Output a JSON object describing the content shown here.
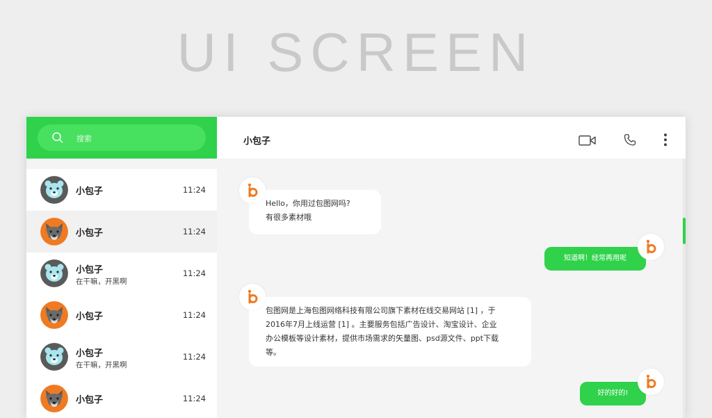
{
  "headline": "UI SCREEN",
  "search": {
    "placeholder": "搜索"
  },
  "contacts": [
    {
      "name": "小包子",
      "time": "11:24",
      "message": "",
      "avatar": "bear-avatar"
    },
    {
      "name": "小包子",
      "time": "11:24",
      "message": "",
      "avatar": "wolf-avatar",
      "selected": true
    },
    {
      "name": "小包子",
      "time": "11:24",
      "message": "在干嘛，开黑啊",
      "avatar": "bear-avatar"
    },
    {
      "name": "小包子",
      "time": "11:24",
      "message": "",
      "avatar": "wolf-avatar"
    },
    {
      "name": "小包子",
      "time": "11:24",
      "message": "在干嘛，开黑啊",
      "avatar": "bear-avatar"
    },
    {
      "name": "小包子",
      "time": "11:24",
      "message": "",
      "avatar": "wolf-avatar"
    }
  ],
  "chat": {
    "title": "小包子",
    "icons": [
      "video-call-icon",
      "phone-icon",
      "more-vertical-icon"
    ],
    "messages": [
      {
        "from": "them",
        "lines": [
          "Hello，你用过包图网吗?",
          "有很多素材哦"
        ]
      },
      {
        "from": "me",
        "text": "知道啊！经常再用呢"
      },
      {
        "from": "them",
        "lines": [
          "包图网是上海包图网络科技有限公司旗下素材在线交易网站 [1] ，于",
          "2016年7月上线运营 [1] 。主要服务包括广告设计、淘宝设计、企业",
          "办公模板等设计素材，提供市场需求的矢量图、psd源文件、ppt下载",
          "等。"
        ]
      },
      {
        "from": "me",
        "text": "好的好的!"
      }
    ]
  },
  "colors": {
    "accent": "#2fd24a",
    "accent_light": "#48e05f",
    "brand_orange": "#ef7a22",
    "background": "#eeeeee"
  }
}
